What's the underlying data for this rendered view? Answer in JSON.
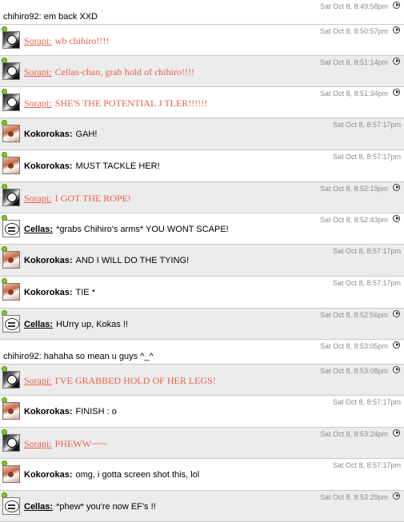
{
  "messages": [
    {
      "type": "plain",
      "bg": "white",
      "height": "short",
      "ts_pos": "a",
      "timestamp": "Sat Oct 8, 8:49:58pm",
      "text": "chihiro92: em back XXD",
      "play": true
    },
    {
      "type": "sorapi",
      "bg": "white",
      "height": "tall",
      "ts_pos": "a",
      "timestamp": "Sat Oct 8, 8:50:57pm",
      "name": "Sorapi:",
      "text": "wb chihiro!!!!",
      "play": true
    },
    {
      "type": "sorapi",
      "bg": "gray",
      "height": "tall",
      "ts_pos": "a",
      "timestamp": "Sat Oct 8, 8:51:14pm",
      "name": "Sorapi:",
      "text": "Cellas-chan, grab hold of chihiro!!!!",
      "play": true
    },
    {
      "type": "sorapi",
      "bg": "white",
      "height": "tall",
      "ts_pos": "a",
      "timestamp": "Sat Oct 8, 8:51:34pm",
      "name": "Sorapi:",
      "text": "SHE'S THE POTENTIAL J TLER!!!!!!",
      "play": true
    },
    {
      "type": "koko",
      "bg": "gray",
      "height": "tall2",
      "ts_pos": "b",
      "timestamp": "Sat Oct 8, 8:57:17pm",
      "name": "Kokorokas:",
      "text": "GAH!",
      "play": false
    },
    {
      "type": "koko",
      "bg": "white",
      "height": "tall2",
      "ts_pos": "b",
      "timestamp": "Sat Oct 8, 8:57:17pm",
      "name": "Kokorokas:",
      "text": "MUST TACKLE HER!",
      "play": false
    },
    {
      "type": "sorapi",
      "bg": "gray",
      "height": "tall",
      "ts_pos": "a",
      "timestamp": "Sat Oct 8, 8:52:19pm",
      "name": "Sorapi:",
      "text": "I GOT THE ROPE!",
      "play": true
    },
    {
      "type": "cellas",
      "bg": "white",
      "height": "tall",
      "ts_pos": "a",
      "timestamp": "Sat Oct 8, 8:52:43pm",
      "name": "Cellas:",
      "text": "*grabs Chihiro's arms* YOU WONT SCAPE!",
      "play": true
    },
    {
      "type": "koko",
      "bg": "gray",
      "height": "tall2",
      "ts_pos": "b",
      "timestamp": "Sat Oct 8, 8:57:17pm",
      "name": "Kokorokas:",
      "text": "AND I WILL DO THE TYING!",
      "play": false
    },
    {
      "type": "koko",
      "bg": "white",
      "height": "tall2",
      "ts_pos": "b",
      "timestamp": "Sat Oct 8, 8:57:17pm",
      "name": "Kokorokas:",
      "text": "TIE *",
      "play": false
    },
    {
      "type": "cellas",
      "bg": "gray",
      "height": "tall",
      "ts_pos": "a",
      "timestamp": "Sat Oct 8, 8:52:56pm",
      "name": "Cellas:",
      "text": "HUrry up, Kokas !!",
      "play": true
    },
    {
      "type": "plain",
      "bg": "white",
      "height": "short",
      "ts_pos": "a",
      "timestamp": "Sat Oct 8, 8:53:05pm",
      "text": "chihiro92: hahaha so mean u guys ^_^",
      "play": true
    },
    {
      "type": "sorapi",
      "bg": "gray",
      "height": "tall",
      "ts_pos": "a",
      "timestamp": "Sat Oct 8, 8:53:08pm",
      "name": "Sorapi:",
      "text": "I'VE GRABBED HOLD OF HER LEGS!",
      "play": true
    },
    {
      "type": "koko",
      "bg": "white",
      "height": "tall2",
      "ts_pos": "b",
      "timestamp": "Sat Oct 8, 8:57:17pm",
      "name": "Kokorokas:",
      "text": "FINISH : o",
      "play": false
    },
    {
      "type": "sorapi",
      "bg": "gray",
      "height": "tall",
      "ts_pos": "a",
      "timestamp": "Sat Oct 8, 8:53:24pm",
      "name": "Sorapi:",
      "text": "PHEWW~~~",
      "play": true
    },
    {
      "type": "koko",
      "bg": "white",
      "height": "tall2",
      "ts_pos": "b",
      "timestamp": "Sat Oct 8, 8:57:17pm",
      "name": "Kokorokas:",
      "text": "omg, i gotta screen shot this, lol",
      "play": false
    },
    {
      "type": "cellas",
      "bg": "gray",
      "height": "tall",
      "ts_pos": "a",
      "timestamp": "Sat Oct 8, 8:53:29pm",
      "name": "Cellas:",
      "text": "*phew* you're now EF's !!",
      "play": true
    }
  ],
  "colors": {
    "sorapi": "#e8604a",
    "cellas": "#d0208a",
    "online_dot": "#7fcc22",
    "timestamp": "#8a8a8a"
  }
}
